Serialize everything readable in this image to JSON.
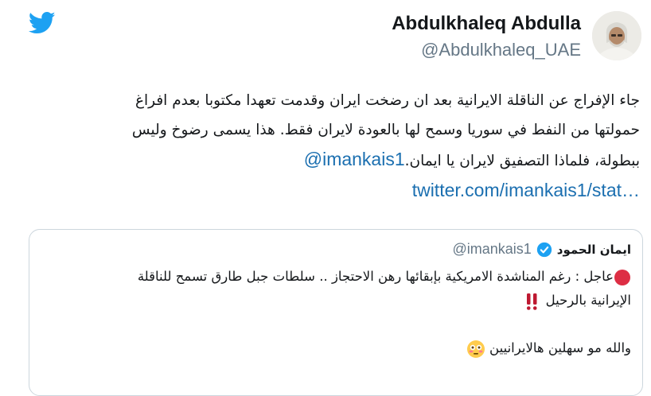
{
  "author": {
    "display_name": "Abdulkhaleq Abdulla",
    "handle": "@Abdulkhaleq_UAE"
  },
  "tweet": {
    "line1": "جاء الإفراج عن الناقلة الايرانية بعد ان رضخت ايران وقدمت تعهدا مكتوبا بعدم افراغ",
    "line2": "حمولتها من النفط في سوريا وسمح لها بالعودة لايران فقط. هذا يسمى رضوخ وليس",
    "line3_text": "ببطولة، فلماذا التصفيق لايران يا ايمان.",
    "mention": "@imankais1",
    "link": "twitter.com/imankais1/stat…"
  },
  "quote": {
    "name": "ايمان الحمود",
    "handle": "@imankais1",
    "line1": "عاجل : رغم المناشدة الامريكية بإبقائها رهن الاحتجاز .. سلطات جبل طارق تسمح للناقلة",
    "line2": "الإيرانية بالرحيل",
    "line3": "والله مو سهلين هالايرانيين"
  },
  "icons": {
    "logo": "twitter-bird-icon",
    "verified": "verified-badge-icon",
    "red_circle": "red-circle-emoji",
    "double_exclamation": "double-exclamation-emoji",
    "flushed_face": "flushed-face-emoji"
  },
  "colors": {
    "twitter_blue": "#1da1f2",
    "link": "#1b6fb0",
    "muted": "#657786",
    "border": "#ccd6dd"
  }
}
